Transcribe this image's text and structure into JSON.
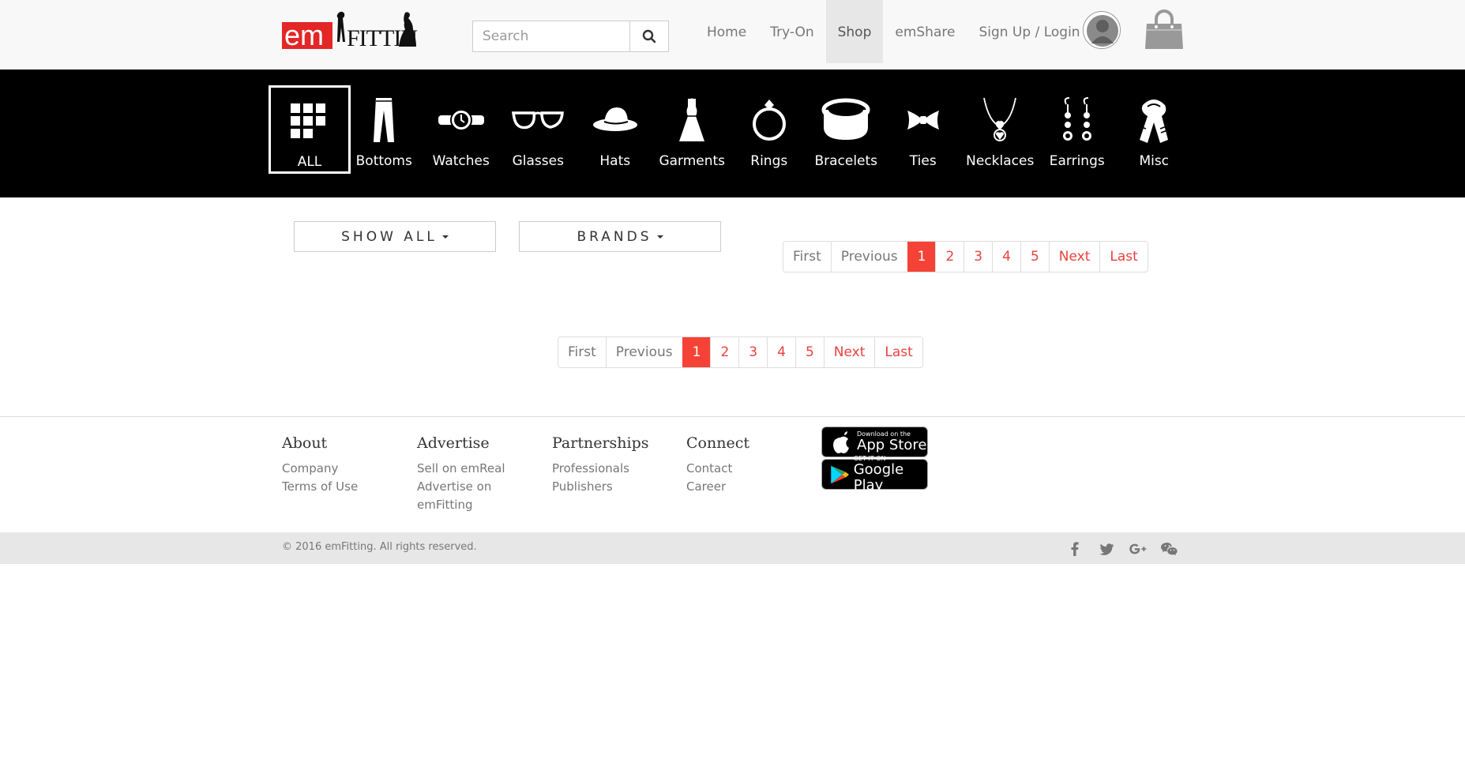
{
  "header": {
    "logo_text_em": "em",
    "logo_text_fitting": "Fitting",
    "search": {
      "placeholder": "Search"
    },
    "nav": [
      {
        "label": "Home",
        "active": false
      },
      {
        "label": "Try-On",
        "active": false
      },
      {
        "label": "Shop",
        "active": true
      },
      {
        "label": "emShare",
        "active": false
      },
      {
        "label": "Sign Up / Login",
        "active": false
      }
    ]
  },
  "categories": [
    {
      "label": "ALL",
      "icon": "grid-icon",
      "selected": true
    },
    {
      "label": "Bottoms",
      "icon": "pants-icon"
    },
    {
      "label": "Watches",
      "icon": "watch-icon"
    },
    {
      "label": "Glasses",
      "icon": "glasses-icon"
    },
    {
      "label": "Hats",
      "icon": "hat-icon"
    },
    {
      "label": "Garments",
      "icon": "dress-icon"
    },
    {
      "label": "Rings",
      "icon": "ring-icon"
    },
    {
      "label": "Bracelets",
      "icon": "bracelet-icon"
    },
    {
      "label": "Ties",
      "icon": "bowtie-icon"
    },
    {
      "label": "Necklaces",
      "icon": "necklace-icon"
    },
    {
      "label": "Earrings",
      "icon": "earrings-icon"
    },
    {
      "label": "Misc",
      "icon": "scarf-icon"
    }
  ],
  "filters": {
    "show_all": "SHOW ALL",
    "brands": "BRANDS"
  },
  "pagination": {
    "first": "First",
    "previous": "Previous",
    "pages": [
      "1",
      "2",
      "3",
      "4",
      "5"
    ],
    "current": "1",
    "next": "Next",
    "last": "Last"
  },
  "footer": {
    "columns": [
      {
        "heading": "About",
        "links": [
          "Company",
          "Terms of Use"
        ]
      },
      {
        "heading": "Advertise",
        "links": [
          "Sell on emReal",
          "Advertise on emFitting"
        ]
      },
      {
        "heading": "Partnerships",
        "links": [
          "Professionals",
          "Publishers"
        ]
      },
      {
        "heading": "Connect",
        "links": [
          "Contact",
          "Career"
        ]
      }
    ],
    "app_store": {
      "small": "Download on the",
      "large": "App Store"
    },
    "google_play": {
      "small": "GET IT ON",
      "large": "Google Play"
    },
    "copyright": "© 2016 emFitting. All rights reserved.",
    "social": [
      "facebook-icon",
      "twitter-icon",
      "google-plus-icon",
      "wechat-icon"
    ]
  },
  "colors": {
    "brand_red": "#e32626",
    "pager_active": "#f44336",
    "pager_link": "#e9413e",
    "category_bar": "#000000"
  }
}
